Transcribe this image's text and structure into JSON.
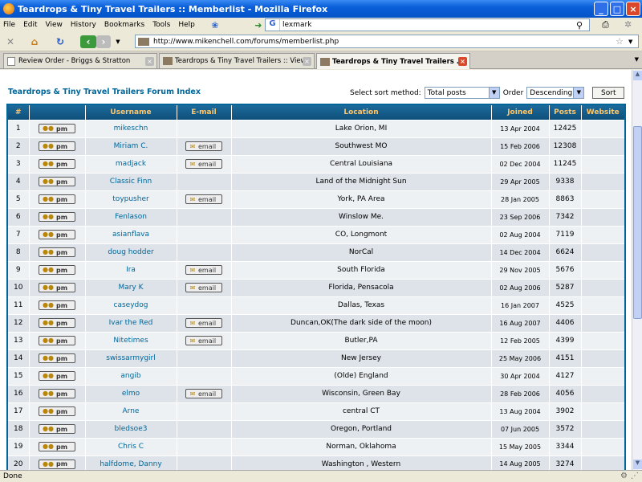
{
  "window": {
    "title": "Teardrops & Tiny Travel Trailers :: Memberlist - Mozilla Firefox"
  },
  "menu": [
    "File",
    "Edit",
    "View",
    "History",
    "Bookmarks",
    "Tools",
    "Help"
  ],
  "search": {
    "engine": "G",
    "value": "lexmark"
  },
  "url": "http://www.mikenchell.com/forums/memberlist.php",
  "tabs": [
    {
      "label": "Review Order - Briggs & Stratton"
    },
    {
      "label": "Teardrops & Tiny Travel Trailers :: View..."
    },
    {
      "label": "Teardrops & Tiny Travel Trailers ..."
    }
  ],
  "page": {
    "forum_index": "Teardrops & Tiny Travel Trailers Forum Index",
    "sort_label": "Select sort method:",
    "sort_value": "Total posts",
    "order_label": "Order",
    "order_value": "Descending",
    "sort_button": "Sort"
  },
  "table": {
    "headers": [
      "#",
      "",
      "Username",
      "E-mail",
      "Location",
      "Joined",
      "Posts",
      "Website"
    ],
    "pm_label": "pm",
    "email_label": "email",
    "rows": [
      {
        "n": "1",
        "user": "mikeschn",
        "email": false,
        "loc": "Lake Orion, MI",
        "joined": "13 Apr 2004",
        "posts": "12425"
      },
      {
        "n": "2",
        "user": "Miriam C.",
        "email": true,
        "loc": "Southwest MO",
        "joined": "15 Feb 2006",
        "posts": "12308"
      },
      {
        "n": "3",
        "user": "madjack",
        "email": true,
        "loc": "Central Louisiana",
        "joined": "02 Dec 2004",
        "posts": "11245"
      },
      {
        "n": "4",
        "user": "Classic Finn",
        "email": false,
        "loc": "Land of the Midnight Sun",
        "joined": "29 Apr 2005",
        "posts": "9338"
      },
      {
        "n": "5",
        "user": "toypusher",
        "email": true,
        "loc": "York, PA Area",
        "joined": "28 Jan 2005",
        "posts": "8863"
      },
      {
        "n": "6",
        "user": "Fenlason",
        "email": false,
        "loc": "Winslow Me.",
        "joined": "23 Sep 2006",
        "posts": "7342"
      },
      {
        "n": "7",
        "user": "asianflava",
        "email": false,
        "loc": "CO, Longmont",
        "joined": "02 Aug 2004",
        "posts": "7119"
      },
      {
        "n": "8",
        "user": "doug hodder",
        "email": false,
        "loc": "NorCal",
        "joined": "14 Dec 2004",
        "posts": "6624"
      },
      {
        "n": "9",
        "user": "Ira",
        "email": true,
        "loc": "South Florida",
        "joined": "29 Nov 2005",
        "posts": "5676"
      },
      {
        "n": "10",
        "user": "Mary K",
        "email": true,
        "loc": "Florida, Pensacola",
        "joined": "02 Aug 2006",
        "posts": "5287"
      },
      {
        "n": "11",
        "user": "caseydog",
        "email": false,
        "loc": "Dallas, Texas",
        "joined": "16 Jan 2007",
        "posts": "4525"
      },
      {
        "n": "12",
        "user": "Ivar the Red",
        "email": true,
        "loc": "Duncan,OK(The dark side of the moon)",
        "joined": "16 Aug 2007",
        "posts": "4406"
      },
      {
        "n": "13",
        "user": "Nitetimes",
        "email": true,
        "loc": "Butler,PA",
        "joined": "12 Feb 2005",
        "posts": "4399"
      },
      {
        "n": "14",
        "user": "swissarmygirl",
        "email": false,
        "loc": "New Jersey",
        "joined": "25 May 2006",
        "posts": "4151"
      },
      {
        "n": "15",
        "user": "angib",
        "email": false,
        "loc": "(Olde) England",
        "joined": "30 Apr 2004",
        "posts": "4127"
      },
      {
        "n": "16",
        "user": "elmo",
        "email": true,
        "loc": "Wisconsin, Green Bay",
        "joined": "28 Feb 2006",
        "posts": "4056"
      },
      {
        "n": "17",
        "user": "Arne",
        "email": false,
        "loc": "central CT",
        "joined": "13 Aug 2004",
        "posts": "3902"
      },
      {
        "n": "18",
        "user": "bledsoe3",
        "email": false,
        "loc": "Oregon, Portland",
        "joined": "07 Jun 2005",
        "posts": "3572"
      },
      {
        "n": "19",
        "user": "Chris C",
        "email": false,
        "loc": "Norman, Oklahoma",
        "joined": "15 May 2005",
        "posts": "3344"
      },
      {
        "n": "20",
        "user": "halfdome, Danny",
        "email": false,
        "loc": "Washington , Western",
        "joined": "14 Aug 2005",
        "posts": "3274"
      }
    ]
  },
  "status": "Done"
}
